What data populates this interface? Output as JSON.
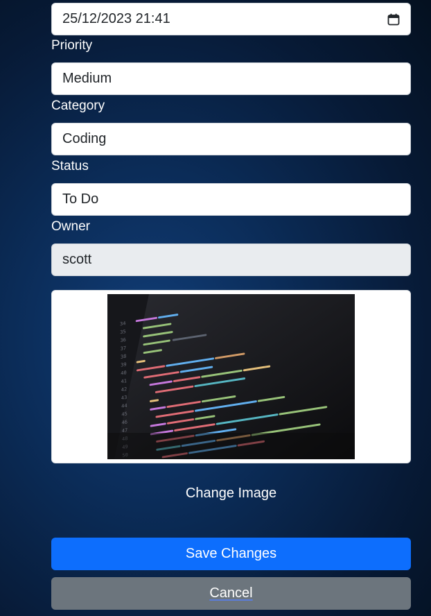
{
  "fields": {
    "due_date": {
      "value": "25/12/2023 21:41"
    },
    "priority": {
      "label": "Priority",
      "value": "Medium"
    },
    "category": {
      "label": "Category",
      "value": "Coding"
    },
    "status": {
      "label": "Status",
      "value": "To Do"
    },
    "owner": {
      "label": "Owner",
      "value": "scott"
    }
  },
  "image": {
    "alt_icon": "code-editor-photo"
  },
  "actions": {
    "change_image": "Change Image",
    "save": "Save Changes",
    "cancel": "Cancel"
  },
  "colors": {
    "primary": "#0d6efd",
    "secondary": "#6c757d",
    "readonly_bg": "#e9ecef"
  }
}
